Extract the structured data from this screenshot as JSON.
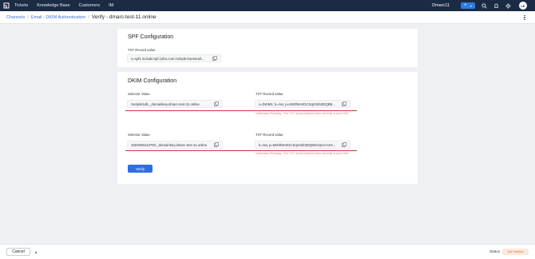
{
  "topbar": {
    "nav": [
      "Tickets",
      "Knowledge Base",
      "Customers",
      "IM"
    ],
    "org_name": "Dmarc11",
    "add_symbol": "+",
    "add_caret": "▾",
    "avatar_initials": "LE"
  },
  "breadcrumb": {
    "channels": "Channels",
    "email_auth": "Email - DKIM Authentication",
    "separator": "/",
    "current": "Verify - dmarc-test-11.online"
  },
  "spf": {
    "title": "SPF Configuration",
    "txt_label": "TXT Record value",
    "txt_value": "v=spf1 include:spf.zoho.com include:transmail..."
  },
  "dkim": {
    "title": "DKIM Configuration",
    "records": [
      {
        "selector_label": "Selector Value",
        "selector_value": "zselpnk1db._domainkey.dmarc-test-11.online",
        "txt_label": "TXT Record value",
        "txt_value": "v=DKIM1; k=rsa; p=MIGfMA0GCSqGSIb3DQEB...",
        "error": "Verification Pending - The TXT record entered does not exist in your DNS"
      },
      {
        "selector_label": "Selector Value",
        "selector_value": "1522905413783._domainkey.dmarc-test-11.online",
        "txt_label": "TXT Record value",
        "txt_value": "k=rsa; p=MIGfMA0GCSqGSIb3DQEBAQUAA4G...",
        "error": "Verification Pending - The TXT record entered does not exist in your DNS"
      }
    ]
  },
  "actions": {
    "verify": "Verify",
    "cancel": "Cancel"
  },
  "footer": {
    "status_label": "Status",
    "status_value": "Not Verified"
  },
  "colors": {
    "topbar": "#1c2b44",
    "accent": "#2f6fe0",
    "error": "#c83a3a",
    "status_bg": "#fce8dc",
    "status_text": "#e0733a"
  },
  "icons": [
    "app-logo-icon",
    "search-icon",
    "bell-icon",
    "gear-icon",
    "copy-icon",
    "more-vertical-icon"
  ]
}
